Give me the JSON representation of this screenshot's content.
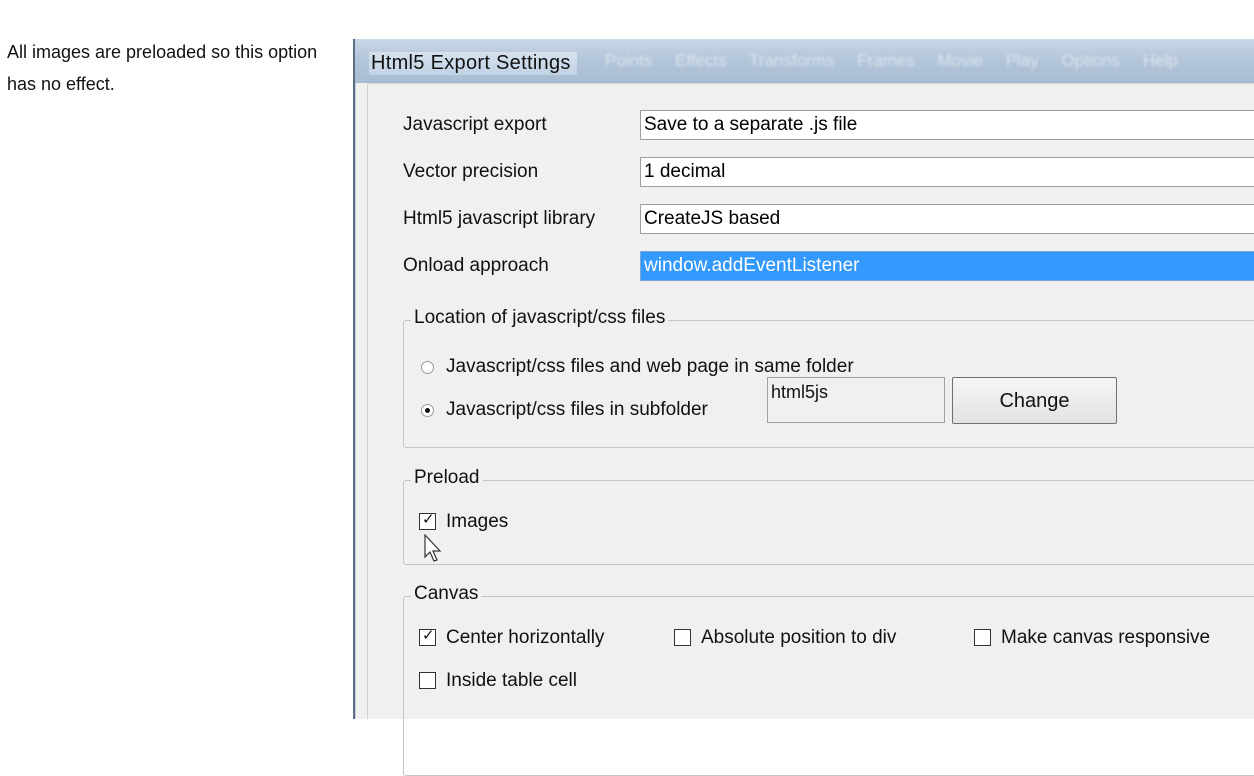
{
  "help": {
    "text": "All images are preloaded so this option has no effect."
  },
  "dialog": {
    "title": "Html5 Export Settings",
    "background_menu": [
      "Points",
      "Effects",
      "Transforms",
      "Frames",
      "Movie",
      "Play",
      "Options",
      "Help"
    ]
  },
  "settings": {
    "javascript_export": {
      "label": "Javascript export",
      "value": "Save to a separate .js file"
    },
    "vector_precision": {
      "label": "Vector precision",
      "value": "1 decimal"
    },
    "js_library": {
      "label": "Html5 javascript library",
      "value": "CreateJS based"
    },
    "onload": {
      "label": "Onload approach",
      "value": "window.addEventListener"
    }
  },
  "location": {
    "title": "Location of javascript/css files",
    "option_same_folder": "Javascript/css files and web page in same folder",
    "option_subfolder": "Javascript/css files in subfolder",
    "selected": "subfolder",
    "subfolder_value": "html5js",
    "change_label": "Change"
  },
  "preload": {
    "title": "Preload",
    "images_label": "Images",
    "images_checked": true
  },
  "canvas": {
    "title": "Canvas",
    "center_horizontally": {
      "label": "Center horizontally",
      "checked": true
    },
    "absolute_position": {
      "label": "Absolute position to div",
      "checked": false
    },
    "responsive": {
      "label": "Make canvas responsive",
      "checked": false
    },
    "inside_table_cell": {
      "label": "Inside table cell",
      "checked": false
    }
  },
  "colors": {
    "selection": "#3399ff",
    "titlebar": "#b4c6da",
    "dialog_bg": "#f0f0f0"
  }
}
